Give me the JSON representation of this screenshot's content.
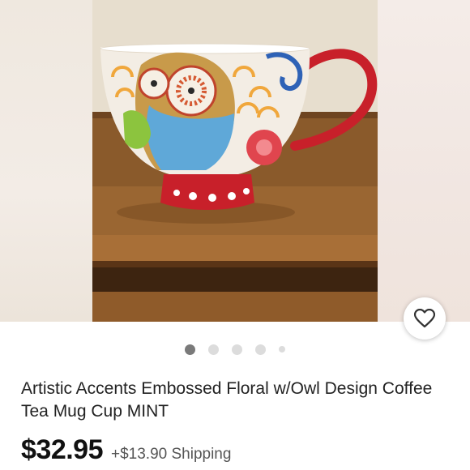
{
  "listing": {
    "title": "Artistic Accents Embossed Floral w/Owl Design Coffee Tea Mug Cup MINT",
    "price": "$32.95",
    "shipping": "+$13.90 Shipping"
  },
  "gallery": {
    "image_count": 5,
    "active_index": 0
  },
  "icons": {
    "favorite": "heart-outline-icon"
  },
  "colors": {
    "dot_active": "#7a7a7a",
    "dot_inactive": "#dcdcdc"
  }
}
